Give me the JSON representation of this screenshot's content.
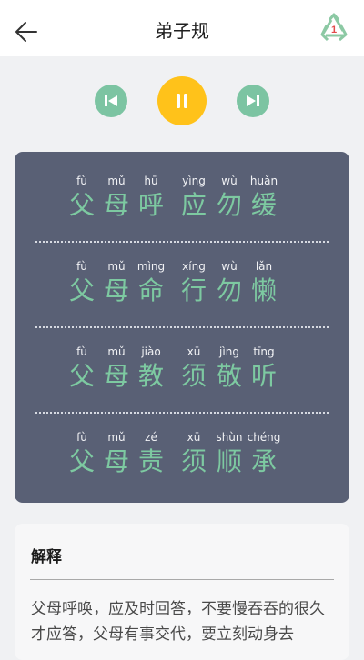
{
  "header": {
    "title": "弟子规",
    "back_icon": "arrow-left-icon",
    "recycle_icon": "recycle-icon",
    "recycle_badge": "1"
  },
  "controls": {
    "prev_icon": "skip-previous-icon",
    "pause_icon": "pause-icon",
    "next_icon": "skip-next-icon"
  },
  "verse": {
    "lines": [
      {
        "pinyin": [
          "fù",
          "mǔ",
          "hū",
          "yìng",
          "wù",
          "huǎn"
        ],
        "chars": [
          "父",
          "母",
          "呼",
          "应",
          "勿",
          "缓"
        ]
      },
      {
        "pinyin": [
          "fù",
          "mǔ",
          "mìng",
          "xíng",
          "wù",
          "lǎn"
        ],
        "chars": [
          "父",
          "母",
          "命",
          "行",
          "勿",
          "懒"
        ]
      },
      {
        "pinyin": [
          "fù",
          "mǔ",
          "jiào",
          "xū",
          "jìng",
          "tīng"
        ],
        "chars": [
          "父",
          "母",
          "教",
          "须",
          "敬",
          "听"
        ]
      },
      {
        "pinyin": [
          "fù",
          "mǔ",
          "zé",
          "xū",
          "shùn",
          "chéng"
        ],
        "chars": [
          "父",
          "母",
          "责",
          "须",
          "顺",
          "承"
        ]
      }
    ]
  },
  "explanation": {
    "heading": "解释",
    "text": "父母呼唤，应及时回答，不要慢吞吞的很久才应答，父母有事交代，要立刻动身去"
  },
  "colors": {
    "accent_green": "#7cc4a2",
    "pause_yellow": "#ffc21a",
    "card_bg": "#596075",
    "char_green": "#7dc9a1"
  }
}
